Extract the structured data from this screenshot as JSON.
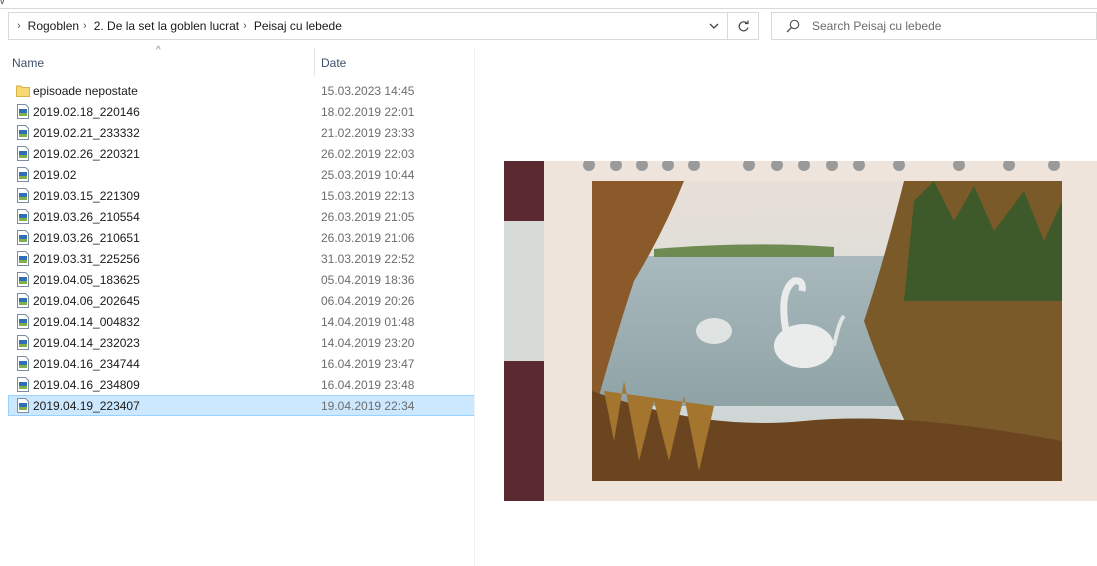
{
  "window": {
    "top_tick": "v"
  },
  "address_bar": {
    "breadcrumbs": [
      "Rogoblen",
      "2. De la set la goblen lucrat",
      "Peisaj cu lebede"
    ],
    "chevron": "›"
  },
  "search": {
    "placeholder": "Search Peisaj cu lebede"
  },
  "columns": {
    "name": "Name",
    "date": "Date"
  },
  "files": [
    {
      "name": "episoade nepostate",
      "date": "15.03.2023 14:45",
      "icon": "folder-icon"
    },
    {
      "name": "2019.02.18_220146",
      "date": "18.02.2019 22:01",
      "icon": "image-file-icon"
    },
    {
      "name": "2019.02.21_233332",
      "date": "21.02.2019 23:33",
      "icon": "image-file-icon"
    },
    {
      "name": "2019.02.26_220321",
      "date": "26.02.2019 22:03",
      "icon": "image-file-icon"
    },
    {
      "name": "2019.02",
      "date": "25.03.2019 10:44",
      "icon": "image-file-icon"
    },
    {
      "name": "2019.03.15_221309",
      "date": "15.03.2019 22:13",
      "icon": "image-file-icon"
    },
    {
      "name": "2019.03.26_210554",
      "date": "26.03.2019 21:05",
      "icon": "image-file-icon"
    },
    {
      "name": "2019.03.26_210651",
      "date": "26.03.2019 21:06",
      "icon": "image-file-icon"
    },
    {
      "name": "2019.03.31_225256",
      "date": "31.03.2019 22:52",
      "icon": "image-file-icon"
    },
    {
      "name": "2019.04.05_183625",
      "date": "05.04.2019 18:36",
      "icon": "image-file-icon"
    },
    {
      "name": "2019.04.06_202645",
      "date": "06.04.2019 20:26",
      "icon": "image-file-icon"
    },
    {
      "name": "2019.04.14_004832",
      "date": "14.04.2019 01:48",
      "icon": "image-file-icon"
    },
    {
      "name": "2019.04.14_232023",
      "date": "14.04.2019 23:20",
      "icon": "image-file-icon"
    },
    {
      "name": "2019.04.16_234744",
      "date": "16.04.2019 23:47",
      "icon": "image-file-icon"
    },
    {
      "name": "2019.04.16_234809",
      "date": "16.04.2019 23:48",
      "icon": "image-file-icon"
    },
    {
      "name": "2019.04.19_223407",
      "date": "19.04.2019 22:34",
      "icon": "image-file-icon",
      "selected": true
    }
  ],
  "colors": {
    "selection": "#cce8ff",
    "selection_border": "#99d1ff",
    "header_text": "#3c5168",
    "folder": "#f8d775"
  }
}
